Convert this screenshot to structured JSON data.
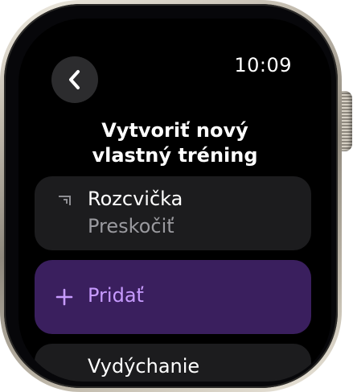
{
  "status": {
    "time": "10:09"
  },
  "header": {
    "title_line1": "Vytvoriť nový",
    "title_line2": "vlastný tréning"
  },
  "warmup": {
    "title": "Rozcvička",
    "subtitle": "Preskočiť",
    "icon": "warmup-bracket-icon"
  },
  "add": {
    "label": "Pridať",
    "icon": "plus-icon"
  },
  "cooldown": {
    "title": "Vydýchanie"
  },
  "colors": {
    "accent": "#c79bff",
    "accent_bg": "#3a1f5e",
    "card_bg": "#1c1c1e",
    "secondary_text": "#9a9a9f"
  }
}
